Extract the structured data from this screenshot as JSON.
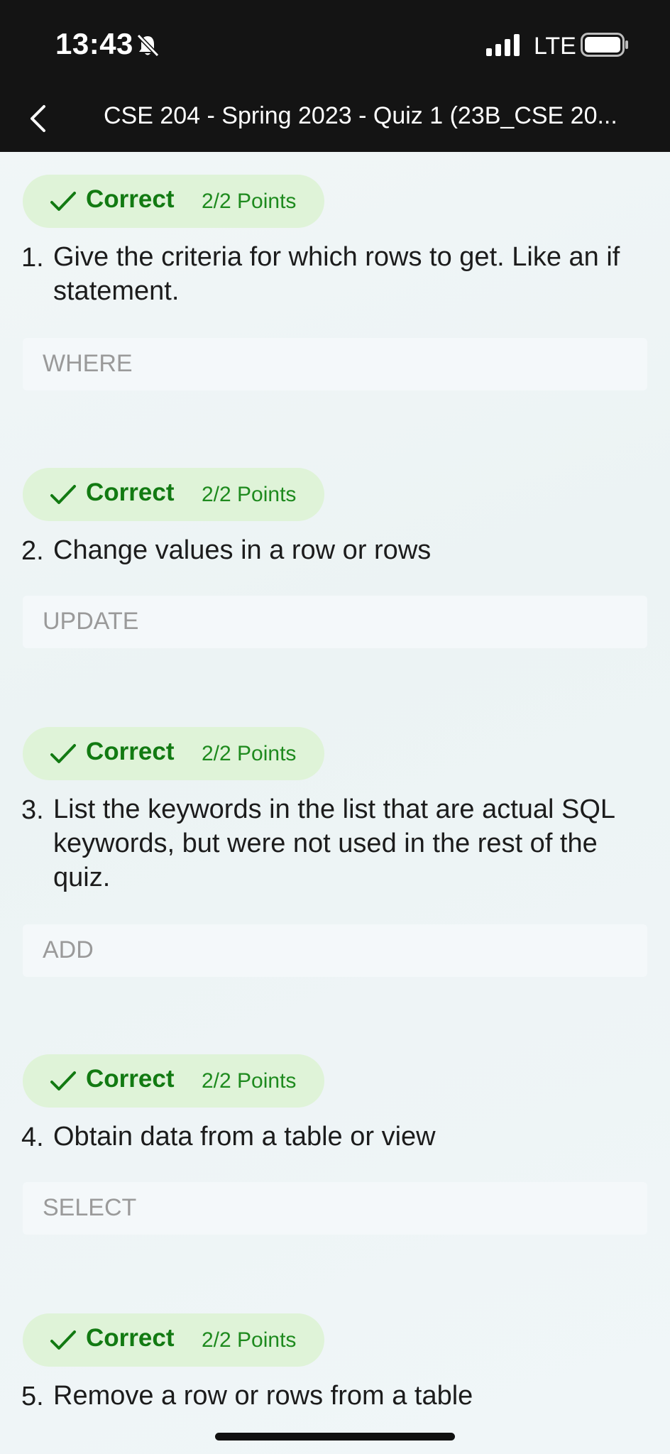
{
  "status_bar": {
    "time": "13:43",
    "network": "LTE"
  },
  "nav": {
    "title": "CSE 204 - Spring 2023 - Quiz 1 (23B_CSE 20..."
  },
  "questions": [
    {
      "status": "Correct",
      "points": "2/2 Points",
      "number": "1.",
      "text": "Give the criteria for which rows to get. Like an if statement.",
      "answer": "WHERE"
    },
    {
      "status": "Correct",
      "points": "2/2 Points",
      "number": "2.",
      "text": "Change values in a row or rows",
      "answer": "UPDATE"
    },
    {
      "status": "Correct",
      "points": "2/2 Points",
      "number": "3.",
      "text": "List the keywords in the list that are actual SQL keywords, but were not used in the rest of the quiz.",
      "answer": "ADD"
    },
    {
      "status": "Correct",
      "points": "2/2 Points",
      "number": "4.",
      "text": "Obtain data from a table or view",
      "answer": "SELECT"
    },
    {
      "status": "Correct",
      "points": "2/2 Points",
      "number": "5.",
      "text": "Remove a row or rows from a table",
      "answer": ""
    }
  ],
  "colors": {
    "status_bar_bg": "#141414",
    "badge_bg": "#dff3d8",
    "correct_text": "#127a12"
  }
}
